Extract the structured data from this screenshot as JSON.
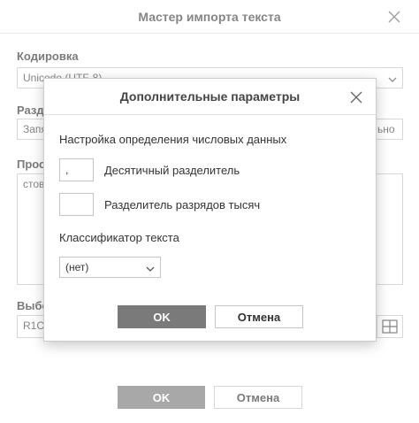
{
  "outer": {
    "title": "Мастер импорта текста",
    "encoding_label": "Кодировка",
    "encoding_value": "Unicode (UTF-8)",
    "delimiter_label": "Разде",
    "delimiter_value": "Запя",
    "delimiter_right_text": "ьно",
    "preview_label": "Прос",
    "preview_text": "стова",
    "select_label": "Выбе",
    "range_value": "R1C",
    "ok_label": "OK",
    "cancel_label": "Отмена"
  },
  "modal": {
    "title": "Дополнительные параметры",
    "section_label": "Настройка определения числовых данных",
    "decimal_separator_label": "Десятичный разделитель",
    "decimal_separator_value": ",",
    "thousands_separator_label": "Разделитель разрядов тысяч",
    "thousands_separator_value": "",
    "text_qualifier_label": "Классификатор текста",
    "text_qualifier_value": "(нет)",
    "ok_label": "OK",
    "cancel_label": "Отмена"
  },
  "icons": {
    "close": "close-icon",
    "chevron": "chevron-down-icon",
    "range": "grid-icon"
  },
  "colors": {
    "primary_button": "#7a7a7a",
    "border": "#c4c4c4"
  }
}
